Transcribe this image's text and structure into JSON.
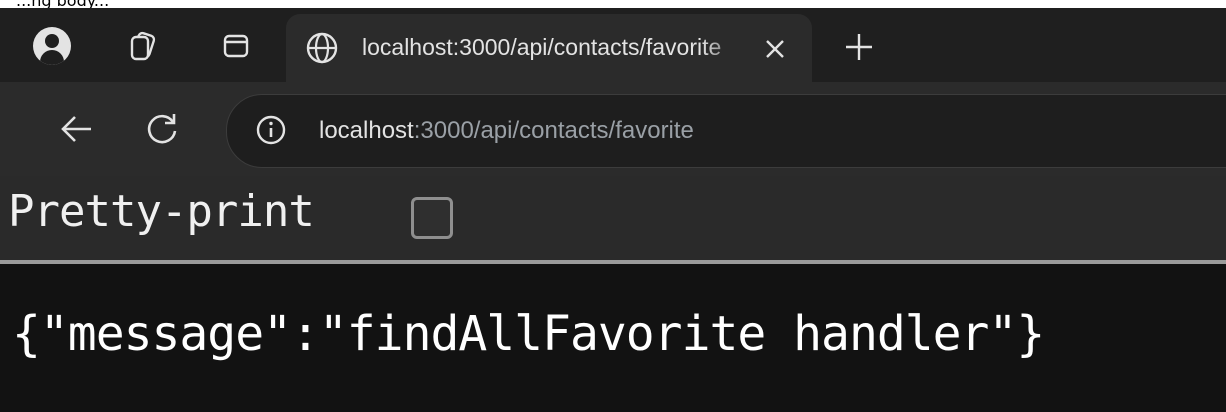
{
  "partial_text": "...ng body...",
  "browser": {
    "tab": {
      "title": "localhost:3000/api/contacts/favorite"
    },
    "address_bar": {
      "host": "localhost",
      "path": ":3000/api/contacts/favorite"
    },
    "icons": {
      "profile": "profile-avatar-icon",
      "workspaces": "workspaces-icon",
      "tab_actions": "tab-actions-icon",
      "globe": "globe-icon",
      "close": "close-icon",
      "new_tab": "plus-icon",
      "back": "back-arrow-icon",
      "reload": "reload-icon",
      "info": "info-icon"
    }
  },
  "viewer": {
    "pretty_print_label": "Pretty-print",
    "pretty_print_checked": false,
    "json_text": "{\"message\":\"findAllFavorite handler\"}"
  },
  "colors": {
    "tab_strip": "#1f1f1f",
    "toolbar": "#2b2b2b",
    "content_bg": "#121212",
    "text": "#e3e3e3",
    "url_dim": "#9aa0a6"
  }
}
